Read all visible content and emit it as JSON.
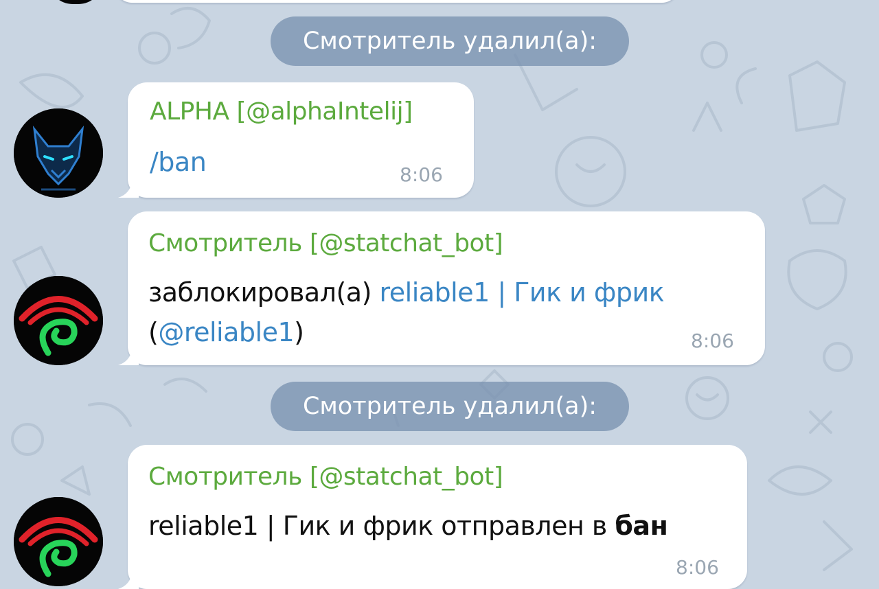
{
  "service_messages": [
    {
      "text": "Смотритель удалил(а):"
    },
    {
      "text": "Смотритель удалил(а):"
    }
  ],
  "messages": [
    {
      "sender": "ALPHA [@alphaIntelij]",
      "text": "/ban",
      "time": "8:06",
      "avatar": "wolf-avatar-icon"
    },
    {
      "sender": "Смотритель [@statchat_bot]",
      "text_prefix": "заблокировал(а) ",
      "user_link": "reliable1 | Гик и фрик",
      "username_open": "(",
      "username_link": "@reliable1",
      "username_close": ")",
      "time": "8:06",
      "avatar": "spiral-eye-avatar-icon"
    },
    {
      "sender": "Смотритель [@statchat_bot]",
      "text_prefix": "reliable1 | Гик и фрик отправлен в ",
      "text_bold": "бан",
      "time": "8:06",
      "avatar": "spiral-eye-avatar-icon"
    }
  ],
  "colors": {
    "background": "#c9d5e2",
    "sender_name": "#5caa3e",
    "link": "#3a86c4",
    "service_pill": "#7a92b0",
    "time": "#9aa6b2"
  }
}
